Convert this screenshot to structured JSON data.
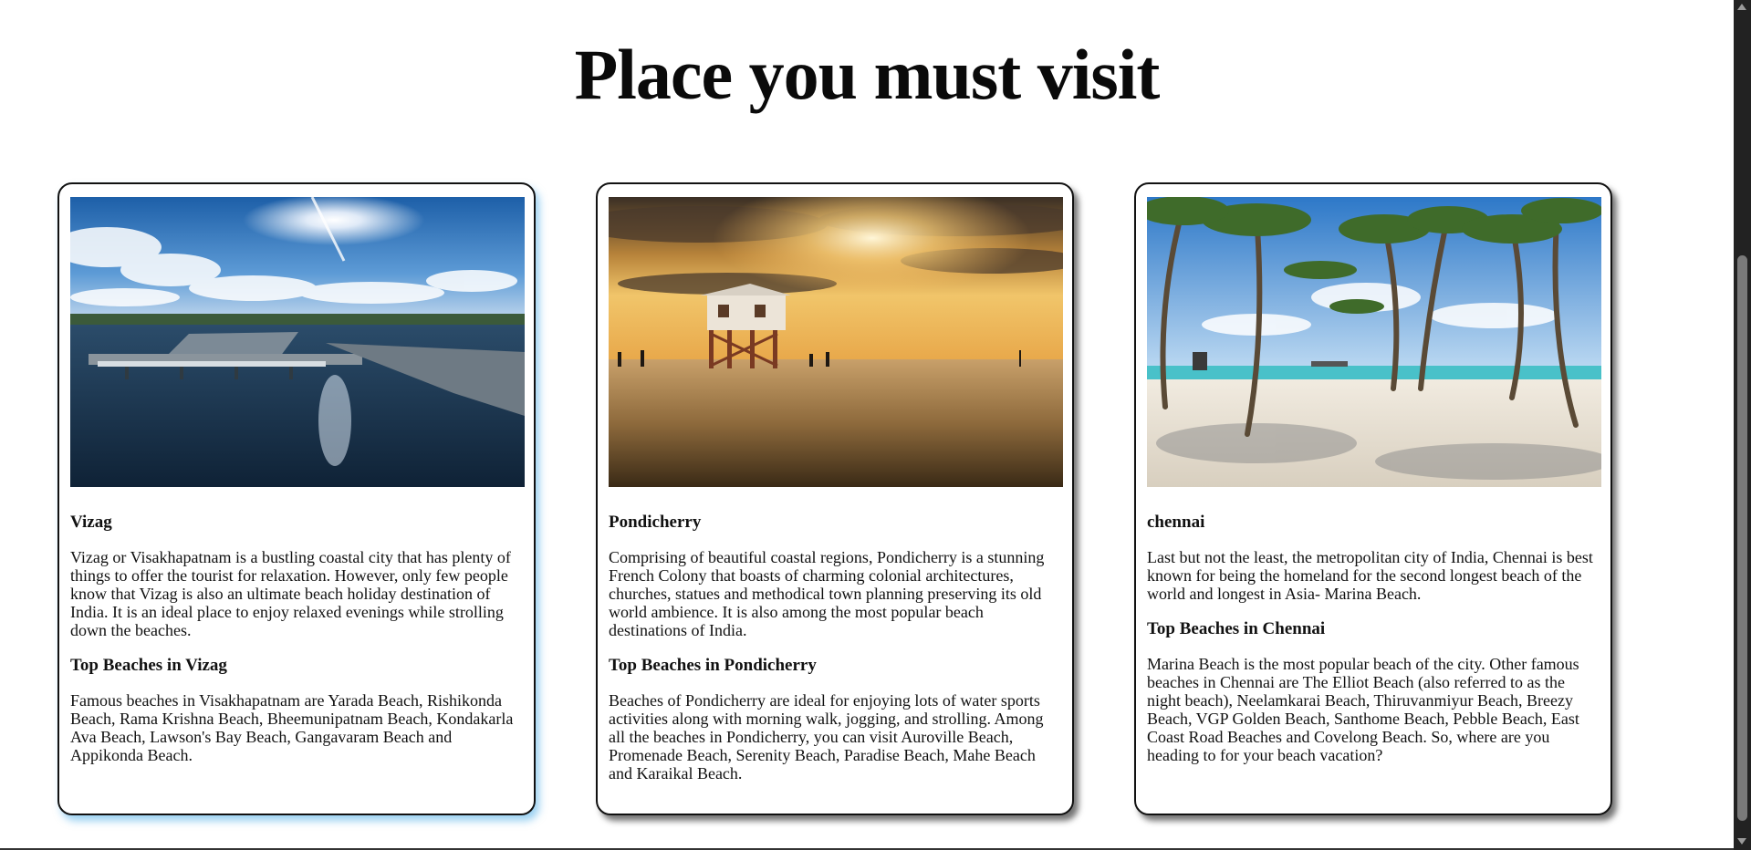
{
  "page": {
    "title": "Place you must visit"
  },
  "cards": [
    {
      "image_alt": "Vizag river and bridge under a bright sun",
      "name": "Vizag",
      "description": "Vizag or Visakhapatnam is a bustling coastal city that has plenty of things to offer the tourist for relaxation. However, only few people know that Vizag is also an ultimate beach holiday destination of India. It is an ideal place to enjoy relaxed evenings while strolling down the beaches.",
      "subheading": "Top Beaches in Vizag",
      "beaches_text": "Famous beaches in Visakhapatnam are Yarada Beach, Rishikonda Beach, Rama Krishna Beach, Bheemunipatnam Beach, Kondakarla Ava Beach, Lawson's Bay Beach, Gangavaram Beach and Appikonda Beach."
    },
    {
      "image_alt": "Stilt hut on a beach at sunset",
      "name": "Pondicherry",
      "description": "Comprising of beautiful coastal regions, Pondicherry is a stunning French Colony that boasts of charming colonial architectures, churches, statues and methodical town planning preserving its old world ambience. It is also among the most popular beach destinations of India.",
      "subheading": "Top Beaches in Pondicherry",
      "beaches_text": "Beaches of Pondicherry are ideal for enjoying lots of water sports activities along with morning walk, jogging, and strolling. Among all the beaches in Pondicherry, you can visit Auroville Beach, Promenade Beach, Serenity Beach, Paradise Beach, Mahe Beach and Karaikal Beach."
    },
    {
      "image_alt": "Palm trees on a white sand beach",
      "name": "chennai",
      "description": "Last but not the least, the metropolitan city of India, Chennai is best known for being the homeland for the second longest beach of the world and longest in Asia- Marina Beach.",
      "subheading": "Top Beaches in Chennai",
      "beaches_text": "Marina Beach is the most popular beach of the city. Other famous beaches in Chennai are The Elliot Beach (also referred to as the night beach), Neelamkarai Beach, Thiruvanmiyur Beach, Breezy Beach, VGP Golden Beach, Santhome Beach, Pebble Beach, East Coast Road Beaches and Covelong Beach. So, where are you heading to for your beach vacation?"
    }
  ],
  "colors": {
    "card_border": "#111111",
    "highlight_shadow": "#46aae6",
    "scrollbar": "#222222"
  }
}
